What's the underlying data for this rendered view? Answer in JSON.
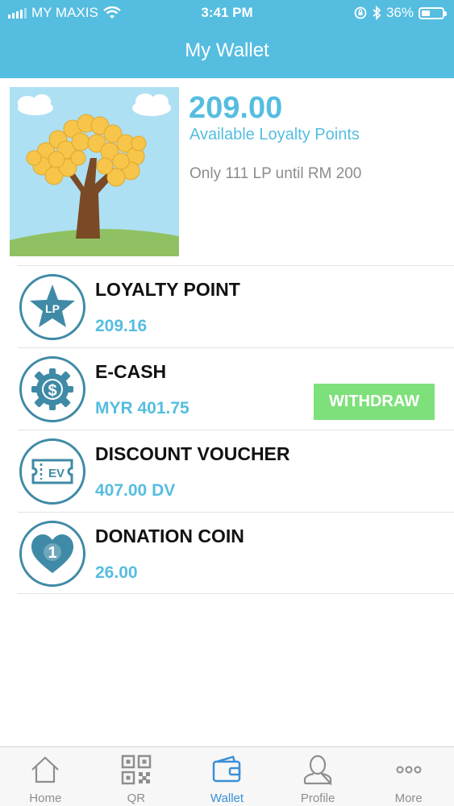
{
  "status_bar": {
    "carrier": "MY MAXIS",
    "time": "3:41 PM",
    "battery": "36%"
  },
  "header": {
    "title": "My Wallet"
  },
  "summary": {
    "points": "209.00",
    "points_label": "Available Loyalty Points",
    "until_text": "Only 111 LP until RM 200"
  },
  "wallet_items": [
    {
      "title": "LOYALTY POINT",
      "value": "209.16",
      "icon": "loyalty-star-icon",
      "icon_text": "LP"
    },
    {
      "title": "E-CASH",
      "value": "MYR 401.75",
      "icon": "ecash-gear-dollar-icon",
      "icon_text": "$",
      "action": "WITHDRAW"
    },
    {
      "title": "DISCOUNT VOUCHER",
      "value": "407.00 DV",
      "icon": "voucher-ticket-icon",
      "icon_text": "EV"
    },
    {
      "title": "DONATION COIN",
      "value": "26.00",
      "icon": "donation-heart-icon",
      "icon_text": "1"
    }
  ],
  "tabs": [
    {
      "label": "Home",
      "icon": "home-icon"
    },
    {
      "label": "QR",
      "icon": "qr-icon"
    },
    {
      "label": "Wallet",
      "icon": "wallet-icon",
      "active": true
    },
    {
      "label": "Profile",
      "icon": "profile-icon"
    },
    {
      "label": "More",
      "icon": "more-icon"
    }
  ],
  "colors": {
    "accent": "#55bde0",
    "icon_ring": "#3f8aa6",
    "withdraw": "#7ee07b",
    "active_tab": "#3a8fd6"
  }
}
